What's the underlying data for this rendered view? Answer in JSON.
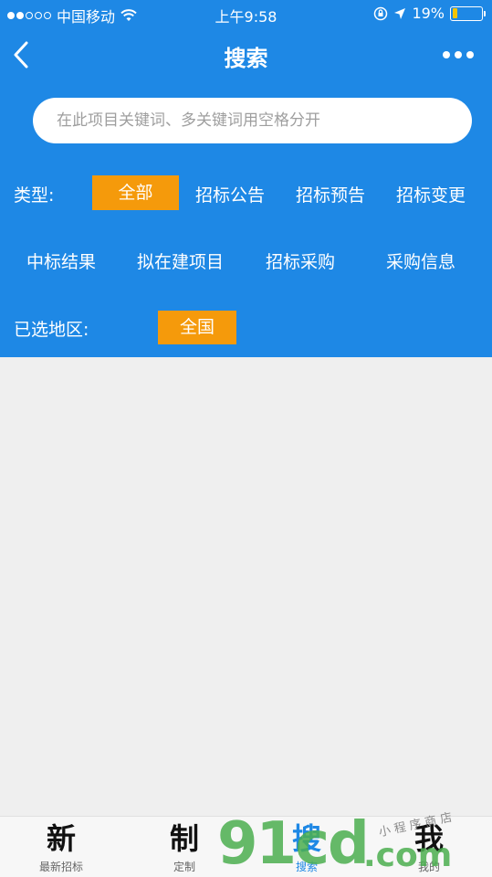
{
  "status": {
    "carrier": "中国移动",
    "time": "上午9:58",
    "battery": "19%",
    "battery_level": 0.19
  },
  "nav": {
    "title": "搜索"
  },
  "search": {
    "placeholder": "在此项目关键词、多关键词用空格分开"
  },
  "filters": {
    "type_label": "类型:",
    "types": [
      "全部",
      "招标公告",
      "招标预告",
      "招标变更",
      "中标结果",
      "拟在建项目",
      "招标采购",
      "采购信息"
    ],
    "region_label": "已选地区:",
    "region_value": "全国"
  },
  "tabbar": {
    "tabs": [
      {
        "icon": "新",
        "label": "最新招标"
      },
      {
        "icon": "制",
        "label": "定制"
      },
      {
        "icon": "搜",
        "label": "搜索"
      },
      {
        "icon": "我",
        "label": "我的"
      }
    ]
  },
  "watermark": {
    "main": "91cd",
    "suffix": ".com",
    "small": "小 程 序 商 店"
  },
  "colors": {
    "primary": "#1e88e5",
    "accent": "#f59a0b",
    "background": "#efefef"
  }
}
